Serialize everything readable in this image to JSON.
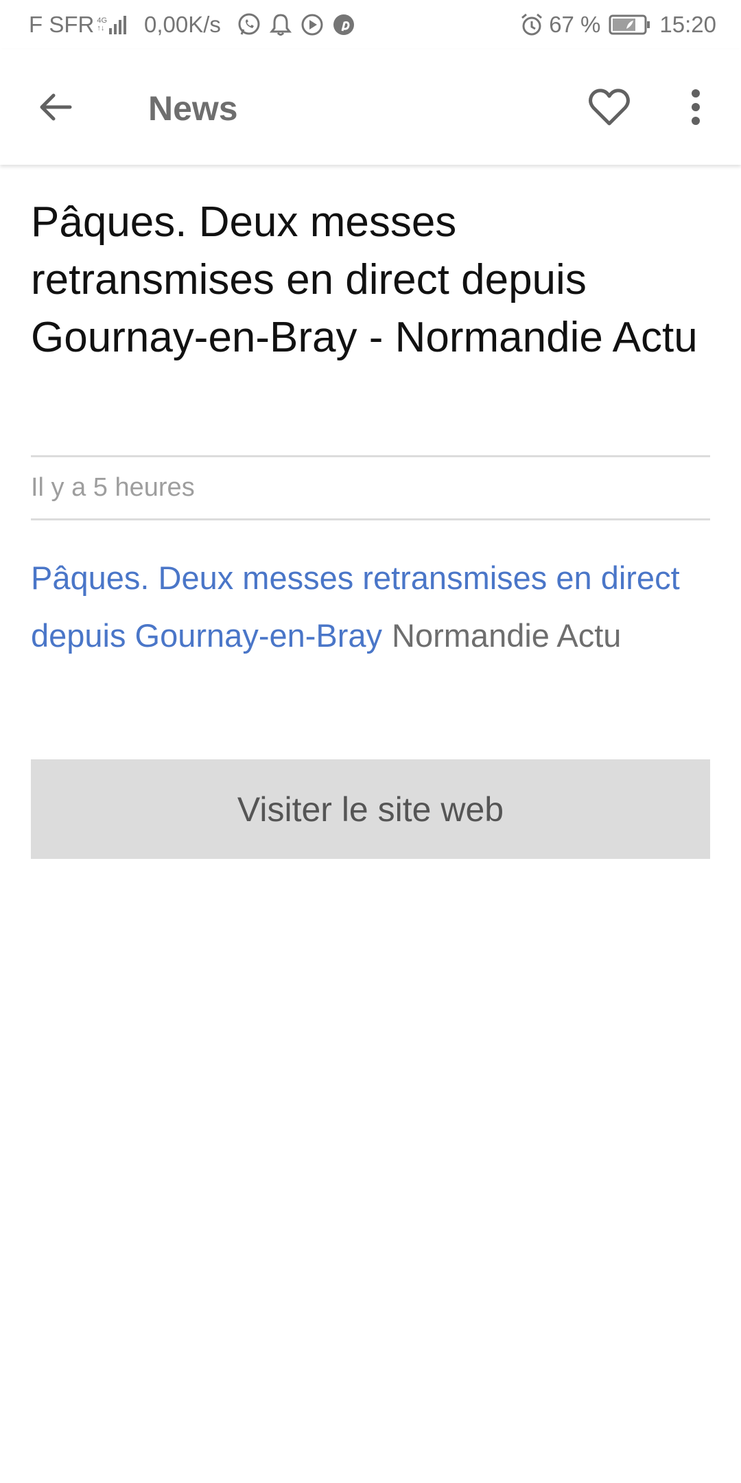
{
  "status_bar": {
    "carrier": "F SFR",
    "network_type_top": "4G",
    "network_type_bottom": "↑↓",
    "speed": "0,00K/s",
    "notification_icons": [
      "whatsapp-icon",
      "bell-icon",
      "play-icon",
      "pinterest-icon"
    ],
    "battery_percent": "67 %",
    "time": "15:20"
  },
  "app_bar": {
    "title": "News",
    "back_icon": "arrow-left-icon",
    "favorite_icon": "heart-outline-icon",
    "more_icon": "more-vert-icon"
  },
  "article": {
    "title": "Pâques. Deux messes retransmises en direct depuis Gournay-en-Bray - Normandie Actu",
    "time_ago": "Il y a 5 heures",
    "link_text": "Pâques. Deux messes retransmises en direct depuis Gournay-en-Bray",
    "source_name": "Normandie Actu",
    "visit_button_label": "Visiter le site web"
  },
  "colors": {
    "link": "#4a76c8",
    "button_bg": "#dcdcdc",
    "title_text": "#111111",
    "muted_text": "#9e9e9e"
  }
}
